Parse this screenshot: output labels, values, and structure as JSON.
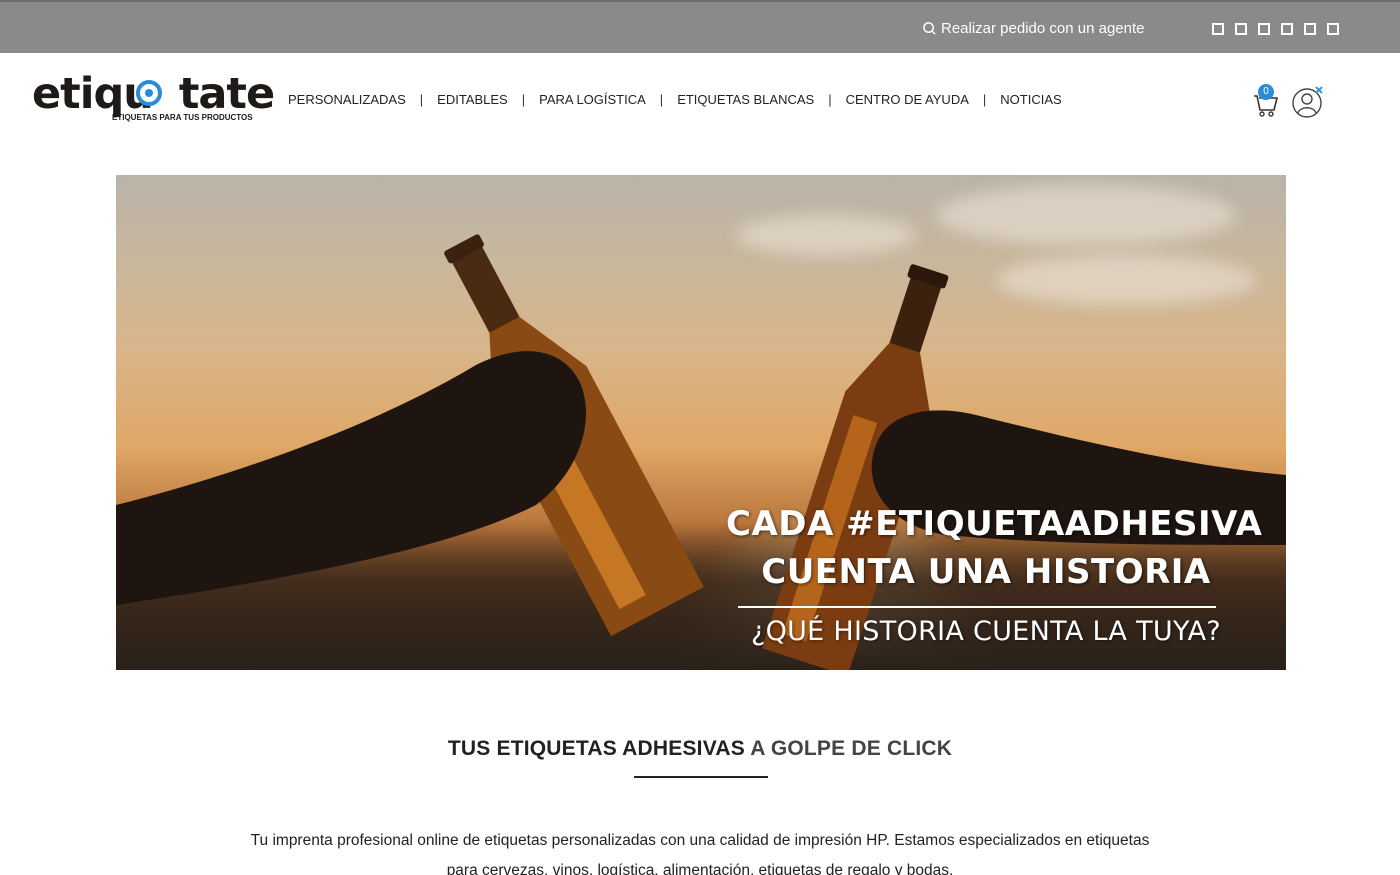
{
  "topbar": {
    "agent_link": "Realizar pedido con un agente",
    "social_icons": [
      "social-icon-1",
      "social-icon-2",
      "social-icon-3",
      "social-icon-4",
      "social-icon-5",
      "social-icon-6"
    ]
  },
  "header": {
    "logo_text": "etiquetate",
    "logo_tagline": "ETIQUETAS PARA TUS PRODUCTOS",
    "nav": [
      {
        "label": "PERSONALIZADAS"
      },
      {
        "label": "EDITABLES"
      },
      {
        "label": "PARA LOGÍSTICA"
      },
      {
        "label": "ETIQUETAS BLANCAS"
      },
      {
        "label": "CENTRO DE AYUDA"
      },
      {
        "label": "NOTICIAS"
      }
    ],
    "nav_separator": "|",
    "cart_count": "0"
  },
  "hero": {
    "line1": "CADA #ETIQUETAADHESIVA",
    "line2": "CUENTA UNA HISTORIA",
    "line3": "¿QUÉ HISTORIA CUENTA LA TUYA?"
  },
  "intro": {
    "title_bold": "TUS ETIQUETAS ADHESIVAS",
    "title_light": " A GOLPE DE CLICK",
    "text": "Tu imprenta profesional online de etiquetas personalizadas con una calidad de impresión HP. Estamos especializados en etiquetas para cervezas, vinos, logística, alimentación, etiquetas de regalo y bodas."
  },
  "colors": {
    "topbar": "#8a8a8a",
    "accent": "#2a8bd8",
    "text": "#222222"
  }
}
